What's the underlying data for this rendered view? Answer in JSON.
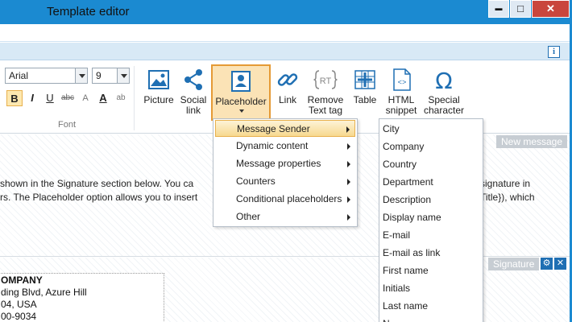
{
  "window": {
    "title": "Template editor"
  },
  "winbuttons": {
    "minimize": "▬",
    "maximize": "□",
    "close": "✕"
  },
  "toolbar": {
    "font_name": "Arial",
    "font_size": "9",
    "group_label": "Font",
    "format_buttons": [
      "B",
      "I",
      "U",
      "abc",
      "A",
      "A",
      "ab"
    ]
  },
  "ribbon": {
    "buttons": [
      {
        "label": "Picture",
        "icon": "picture-icon"
      },
      {
        "label": "Social\nlink",
        "icon": "share-icon"
      },
      {
        "label": "Placeholder",
        "icon": "placeholder-icon"
      },
      {
        "label": "Link",
        "icon": "link-icon"
      },
      {
        "label": "Remove\nText tag",
        "icon": "remove-tag-icon"
      },
      {
        "label": "Table",
        "icon": "table-icon"
      },
      {
        "label": "HTML\nsnippet",
        "icon": "html-icon"
      },
      {
        "label": "Special\ncharacter",
        "icon": "omega-icon"
      }
    ]
  },
  "content": {
    "new_message_tag": "New message",
    "line1_left": "shown in the Signature section below. You ca",
    "line1_right": "signature in",
    "line2_left": "rs. The Placeholder option allows you to insert",
    "line2_right": "Title}), which",
    "signature_tag": "Signature",
    "signature_lines": [
      "OMPANY",
      "ding Blvd, Azure Hill",
      "04, USA",
      "00-9034"
    ]
  },
  "menu_placeholder": {
    "items": [
      "Message Sender",
      "Dynamic content",
      "Message properties",
      "Counters",
      "Conditional placeholders",
      "Other"
    ],
    "highlighted": 0
  },
  "menu_sender": {
    "items": [
      "City",
      "Company",
      "Country",
      "Department",
      "Description",
      "Display name",
      "E-mail",
      "E-mail as link",
      "First name",
      "Initials",
      "Last name",
      "N..."
    ]
  },
  "colors": {
    "accent": "#1b8ad1",
    "highlight": "#f7d98f",
    "close": "#c9463d"
  }
}
